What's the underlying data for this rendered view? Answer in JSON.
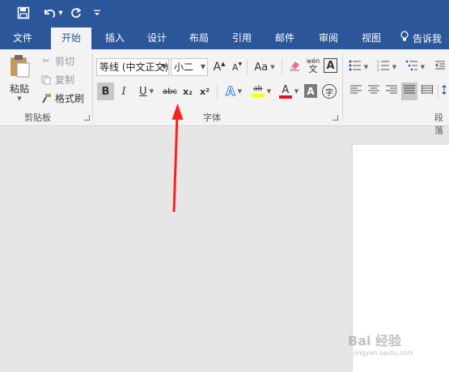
{
  "quick_access": {
    "save_icon": "save-icon",
    "undo_icon": "undo-icon",
    "redo_icon": "redo-icon",
    "customize_icon": "customize-icon"
  },
  "tabs": [
    "文件",
    "开始",
    "插入",
    "设计",
    "布局",
    "引用",
    "邮件",
    "审阅",
    "视图"
  ],
  "active_tab": "开始",
  "tell_me": "告诉我",
  "clipboard": {
    "paste": "粘贴",
    "cut": "剪切",
    "copy": "复制",
    "format_painter": "格式刷",
    "group_label": "剪贴板"
  },
  "font": {
    "font_name": "等线 (中文正文)",
    "font_size": "小二",
    "grow_label": "A",
    "shrink_label": "A",
    "change_case_label": "Aa",
    "phonetic_top": "wén",
    "phonetic_bottom": "文",
    "border_label": "A",
    "bold": "B",
    "italic": "I",
    "underline": "U",
    "strikethrough": "abc",
    "subscript": "x₂",
    "superscript": "x²",
    "effects_label": "A",
    "highlight_label": "ab",
    "font_color_label": "A",
    "shading_label": "A",
    "enclose_label": "字",
    "group_label": "字体"
  },
  "paragraph": {
    "group_label": "段落"
  },
  "colors": {
    "brand": "#2b579a",
    "ribbon_bg": "#f3f3f3",
    "arrow": "#ff2020",
    "highlight": "#ffff00",
    "font_color": "#e81123"
  },
  "watermark": {
    "text": "Bai 经验",
    "url": "jingyan.baidu.com"
  }
}
